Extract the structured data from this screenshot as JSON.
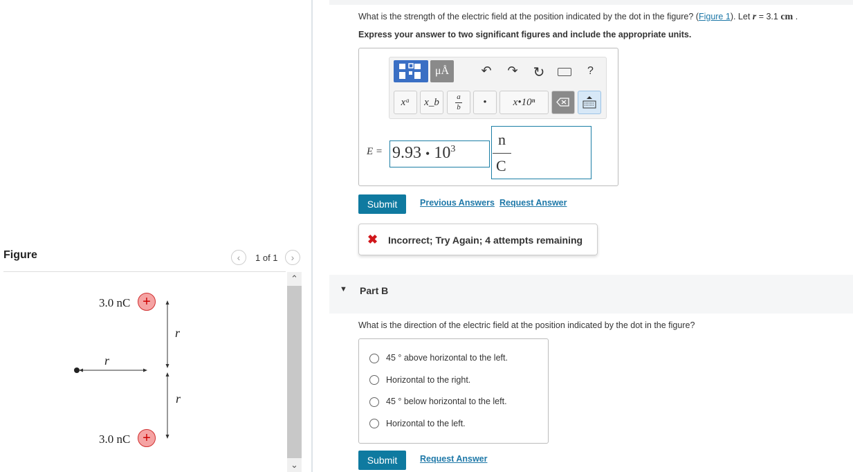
{
  "figure_panel": {
    "title": "Figure",
    "pager": "1 of 1",
    "prev_icon": "chevron-left-icon",
    "next_icon": "chevron-right-icon",
    "diagram": {
      "top_charge_label": "3.0 nC",
      "bottom_charge_label": "3.0 nC",
      "charge_sign": "+",
      "r_vertical_top": "r",
      "r_vertical_bottom": "r",
      "r_horizontal": "r"
    }
  },
  "part_a": {
    "question_prefix": "What is the strength of the electric field at the position indicated by the dot in the figure? (",
    "figure_link": "Figure 1",
    "question_mid": "). Let ",
    "r_symbol": "r",
    "r_equals": " = 3.1 ",
    "r_unit": "cm",
    "r_period": " .",
    "instruction": "Express your answer to two significant figures and include the appropriate units.",
    "toolbar": {
      "template_icon": "templates-icon",
      "units_button": "μÅ",
      "undo_icon": "undo-icon",
      "redo_icon": "redo-icon",
      "reset_icon": "reset-icon",
      "keyboard_icon": "keyboard-icon",
      "help": "?",
      "superscript": "xᵃ",
      "subscript": "x_b",
      "fraction_num": "a",
      "fraction_den": "b",
      "dot": "•",
      "sci_notation": "x•10ⁿ",
      "delete_icon": "backspace-icon",
      "keyboard_toggle_icon": "keyboard-toggle-icon"
    },
    "equation_label": "E =",
    "value_mantissa": "9.93",
    "value_dot": "•",
    "value_base": "10",
    "value_exponent": "3",
    "unit_numerator": "n",
    "unit_denominator": "C",
    "submit_label": "Submit",
    "previous_answers": "Previous Answers",
    "request_answer": "Request Answer",
    "feedback_icon": "x-icon",
    "feedback_text": "Incorrect; Try Again; 4 attempts remaining"
  },
  "part_b": {
    "title": "Part B",
    "question": "What is the direction of the electric field at the position indicated by the dot in the figure?",
    "options": [
      "45 ° above horizontal to the left.",
      "Horizontal to the right.",
      "45 ° below horizontal to the left.",
      "Horizontal to the left."
    ],
    "submit_label": "Submit",
    "request_answer": "Request Answer"
  },
  "colors": {
    "accent": "#0f7aa0",
    "link": "#1e78a8",
    "error": "#d0171b",
    "charge_fill": "#f5a3a3"
  }
}
